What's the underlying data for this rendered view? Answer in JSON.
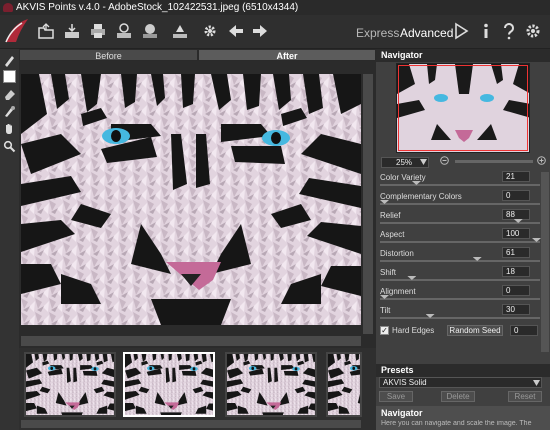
{
  "window": {
    "title": "AKVIS Points v.4.0 - AdobeStock_102422531.jpeg (6510x4344)"
  },
  "toolbar": {
    "modes": {
      "express": "Express",
      "advanced": "Advanced"
    },
    "icons": [
      "open-icon",
      "save-icon",
      "print-icon",
      "share-icon",
      "batch-icon",
      "before-after-icon",
      "preferences-icon",
      "undo-icon",
      "redo-icon",
      "run-icon",
      "info-icon",
      "help-icon",
      "settings-icon"
    ]
  },
  "tabs": {
    "before": "Before",
    "after": "After"
  },
  "navigator": {
    "title": "Navigator",
    "zoom": "25%"
  },
  "params": [
    {
      "label": "Color Variety",
      "value": "21",
      "level": 0.21
    },
    {
      "label": "Complementary Colors",
      "value": "0",
      "level": 0.0
    },
    {
      "label": "Relief",
      "value": "88",
      "level": 0.88
    },
    {
      "label": "Aspect",
      "value": "100",
      "level": 1.0
    },
    {
      "label": "Distortion",
      "value": "61",
      "level": 0.61
    },
    {
      "label": "Shift",
      "value": "18",
      "level": 0.18
    },
    {
      "label": "Alignment",
      "value": "0",
      "level": 0.0
    },
    {
      "label": "Tilt",
      "value": "30",
      "level": 0.3
    }
  ],
  "hard_edges": {
    "label": "Hard Edges",
    "checked": true
  },
  "random_seed": {
    "label": "Random Seed",
    "value": "0"
  },
  "presets": {
    "title": "Presets",
    "selected": "AKVIS Solid",
    "save": "Save",
    "delete": "Delete",
    "reset": "Reset"
  },
  "help": {
    "title": "Navigator",
    "text": "Here you can navigate and scale the image. The"
  },
  "colors": {
    "accent_red": "#dd3333",
    "eye_blue": "#45b8e0",
    "panel": "#404040"
  }
}
